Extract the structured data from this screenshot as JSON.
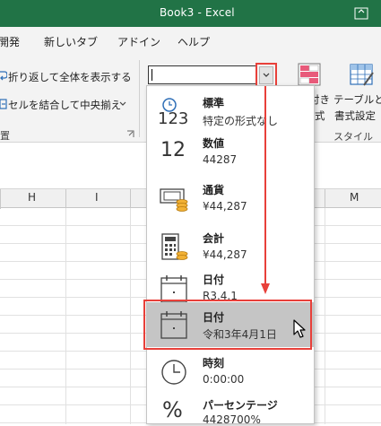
{
  "titlebar": {
    "title": "Book3  -  Excel"
  },
  "tabs": [
    {
      "label": "開発"
    },
    {
      "label": "新しいタブ"
    },
    {
      "label": "アドイン"
    },
    {
      "label": "ヘルプ"
    }
  ],
  "ribbon": {
    "wrap_text": "折り返して全体を表示する",
    "merge_center": "セルを結合して中央揃え",
    "number_format_value": "",
    "conditional_line1": "付き",
    "conditional_line2": "式",
    "table_line1": "テーブルとし",
    "table_line2": "書式設定",
    "styles_group_label": "スタイル"
  },
  "columns": [
    "H",
    "I",
    "M"
  ],
  "number_formats": [
    {
      "name": "標準",
      "sample": "特定の形式なし",
      "icon": "clock-123-icon"
    },
    {
      "name": "数値",
      "sample": "44287",
      "icon": "number-12-icon"
    },
    {
      "name": "通貨",
      "sample": "¥44,287",
      "icon": "currency-icon"
    },
    {
      "name": "会計",
      "sample": "¥44,287",
      "icon": "calculator-icon"
    },
    {
      "name": "日付",
      "sample": "R3.4.1",
      "icon": "calendar-icon"
    },
    {
      "name": "日付",
      "sample": "令和3年4月1日",
      "icon": "calendar-icon",
      "selected": true
    },
    {
      "name": "時刻",
      "sample": "0:00:00",
      "icon": "clock-icon"
    },
    {
      "name": "パーセンテージ",
      "sample": "4428700%",
      "icon": "percent-icon"
    }
  ],
  "icon_text": {
    "num123": "123",
    "num12": "12",
    "percent": "%"
  },
  "colors": {
    "titlebar": "#217346",
    "highlight": "#e8403a",
    "selected_item": "#c5c5c5"
  }
}
